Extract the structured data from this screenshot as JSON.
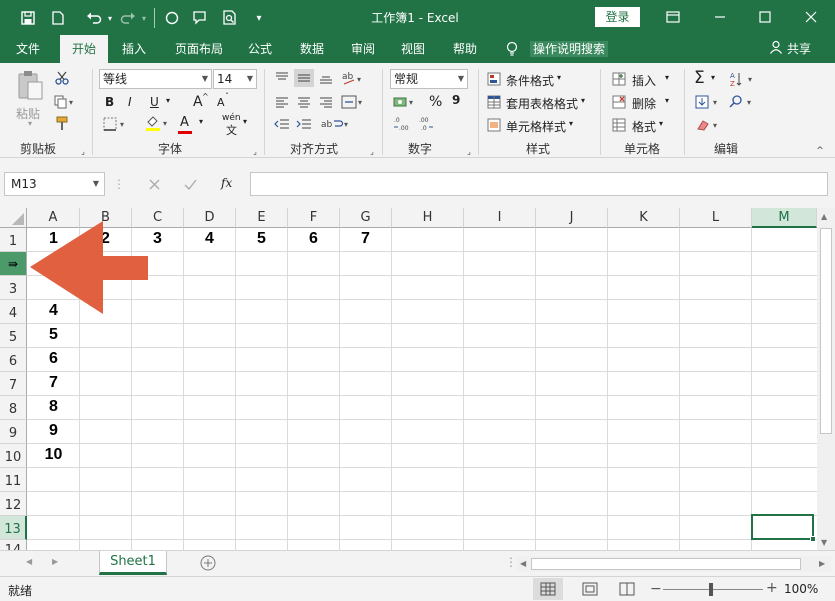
{
  "title_bar": {
    "title": "工作簿1  -  Excel",
    "login": "登录",
    "quick_access": [
      "save-icon",
      "new-icon",
      "undo-icon",
      "redo-icon",
      "circle-icon",
      "comment-icon",
      "preview-icon",
      "more-icon"
    ]
  },
  "tabs": [
    "文件",
    "开始",
    "插入",
    "页面布局",
    "公式",
    "数据",
    "审阅",
    "视图",
    "帮助"
  ],
  "active_tab": "开始",
  "tell_me": "操作说明搜索",
  "share": "共享",
  "ribbon": {
    "clipboard": {
      "paste": "粘贴",
      "label": "剪贴板"
    },
    "font": {
      "name": "等线",
      "size": "14",
      "label": "字体",
      "bold": "B",
      "italic": "I",
      "underline": "U",
      "grow": "A",
      "shrink": "A",
      "font_color": "A",
      "phonetic": "wén"
    },
    "alignment": {
      "label": "对齐方式"
    },
    "number": {
      "format": "常规",
      "percent": "%",
      "comma": "9",
      "label": "数字"
    },
    "styles": {
      "conditional": "条件格式",
      "table": "套用表格格式",
      "cell": "单元格样式",
      "label": "样式"
    },
    "cells": {
      "insert": "插入",
      "delete": "删除",
      "format": "格式",
      "label": "单元格"
    },
    "editing": {
      "label": "编辑"
    }
  },
  "formula_bar": {
    "name_box": "M13",
    "fx": "fx",
    "formula": ""
  },
  "columns": [
    "A",
    "B",
    "C",
    "D",
    "E",
    "F",
    "G",
    "H",
    "I",
    "J",
    "K",
    "L",
    "M"
  ],
  "selected_column": "M",
  "rows": [
    "1",
    "2",
    "3",
    "4",
    "5",
    "6",
    "7",
    "8",
    "9",
    "10",
    "11",
    "12",
    "13",
    "14"
  ],
  "selected_row": "13",
  "row1_values": [
    "1",
    "2",
    "3",
    "4",
    "5",
    "6",
    "7"
  ],
  "colA_values": [
    "4",
    "5",
    "6",
    "7",
    "8",
    "9",
    "10"
  ],
  "row2_header_icon": "⇛",
  "sheet_tabs": [
    "Sheet1"
  ],
  "status": {
    "ready": "就绪",
    "zoom": "100%"
  },
  "colors": {
    "excel_green": "#217346",
    "annotation_arrow": "#e0603f",
    "selection_green": "#217346"
  }
}
